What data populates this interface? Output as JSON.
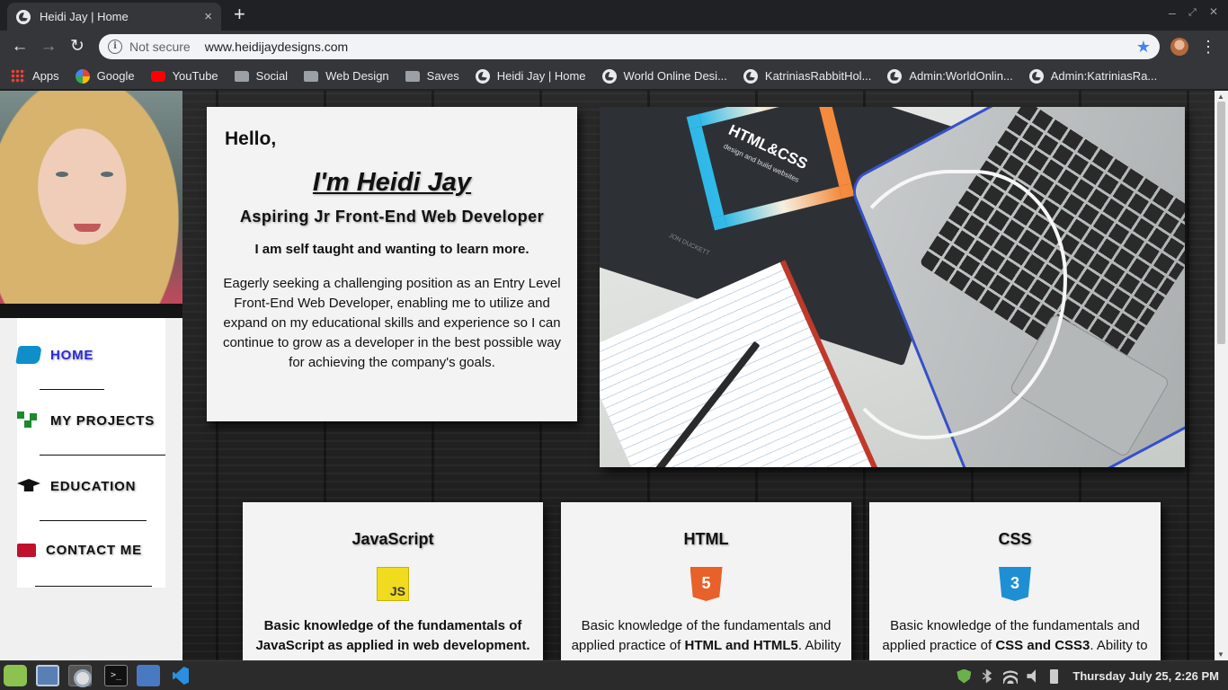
{
  "browser": {
    "tab_title": "Heidi Jay | Home",
    "tab_close": "×",
    "new_tab": "+",
    "security_label": "Not secure",
    "url": "www.heidijaydesigns.com",
    "back": "←",
    "forward": "→",
    "reload": "↻",
    "star": "★",
    "menu": "⋮",
    "minimize": "–",
    "maximize": "⤢",
    "close": "✕"
  },
  "bookmarks": [
    {
      "label": "Apps",
      "icon": "apps-icon"
    },
    {
      "label": "Google",
      "icon": "google-icon"
    },
    {
      "label": "YouTube",
      "icon": "youtube-icon"
    },
    {
      "label": "Social",
      "icon": "folder-icon"
    },
    {
      "label": "Web Design",
      "icon": "folder-icon"
    },
    {
      "label": "Saves",
      "icon": "folder-icon"
    },
    {
      "label": "Heidi Jay | Home",
      "icon": "globe-icon"
    },
    {
      "label": "World Online Desi...",
      "icon": "globe-icon"
    },
    {
      "label": "KatriniasRabbitHol...",
      "icon": "globe-icon"
    },
    {
      "label": "Admin:WorldOnlin...",
      "icon": "globe-icon"
    },
    {
      "label": "Admin:KatriniasRa...",
      "icon": "globe-icon"
    }
  ],
  "nav": {
    "items": [
      {
        "label": "HOME",
        "icon": "home-icon",
        "active": true
      },
      {
        "label": "MY PROJECTS",
        "icon": "projects-icon",
        "active": false
      },
      {
        "label": "EDUCATION",
        "icon": "graduation-cap-icon",
        "active": false
      },
      {
        "label": "CONTACT ME",
        "icon": "envelope-icon",
        "active": false
      }
    ]
  },
  "intro": {
    "greeting": "Hello,",
    "name": "I'm Heidi Jay",
    "role": "Aspiring Jr Front-End Web Developer",
    "tagline": "I am self taught and wanting to learn more.",
    "blurb": "Eagerly seeking a challenging position as an Entry Level Front-End Web Developer, enabling me to utilize and expand on my educational skills and experience so I can continue to grow as a developer in the best possible way for achieving the company's goals."
  },
  "hero": {
    "book_title": "HTML&CSS",
    "book_subtitle": "design and build websites",
    "book_author": "JON DUCKETT"
  },
  "skills": [
    {
      "title": "JavaScript",
      "logo": "JS",
      "icon": "javascript-logo-icon",
      "text": "Basic knowledge of the fundamentals of JavaScript as applied in web development."
    },
    {
      "title": "HTML",
      "logo": "5",
      "icon": "html5-logo-icon",
      "text_pre": "Basic knowledge of the fundamentals and applied practice of ",
      "text_bold": "HTML and HTML5",
      "text_post": ". Ability"
    },
    {
      "title": "CSS",
      "logo": "3",
      "icon": "css3-logo-icon",
      "text_pre": "Basic knowledge of the fundamentals and applied practice of ",
      "text_bold": "CSS and CSS3",
      "text_post": ". Ability to"
    }
  ],
  "taskbar": {
    "terminal_glyph": ">_",
    "clock": "Thursday July 25,  2:26 PM"
  },
  "colors": {
    "nav_active": "#2b2bd6",
    "tab_bar": "#202124",
    "toolbar": "#35363a",
    "card": "#f3f3f3"
  }
}
